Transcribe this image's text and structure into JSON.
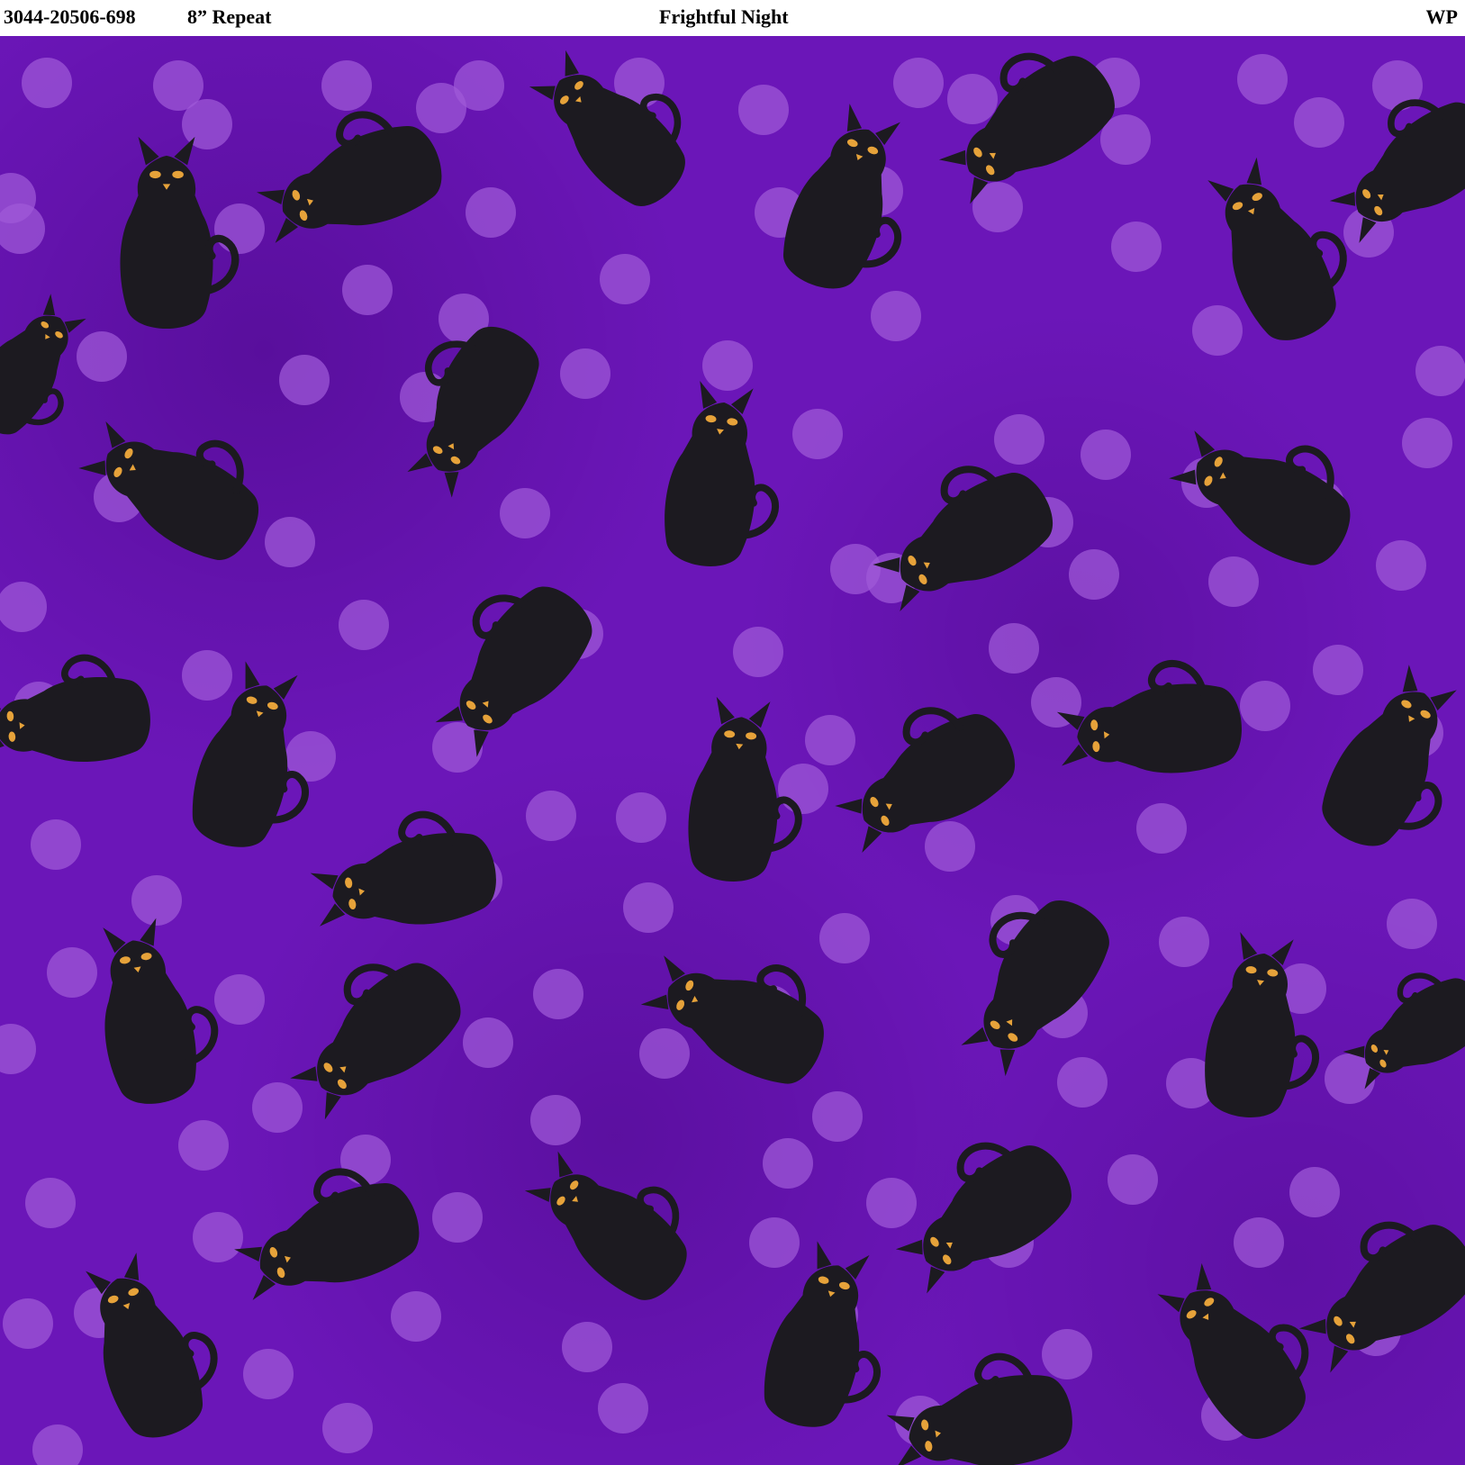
{
  "header": {
    "sku": "3044-20506-698",
    "repeat": "8” Repeat",
    "title": "Frightful Night",
    "mark": "WP"
  },
  "colors": {
    "background": "#6b16b8",
    "dot": "#a05ad8",
    "cat": "#1c1a20",
    "eyes": "#e6a23a",
    "header_bg": "#ffffff",
    "header_text": "#000000"
  },
  "pattern": {
    "motif": "black-cat",
    "accent": "polka-dot"
  }
}
